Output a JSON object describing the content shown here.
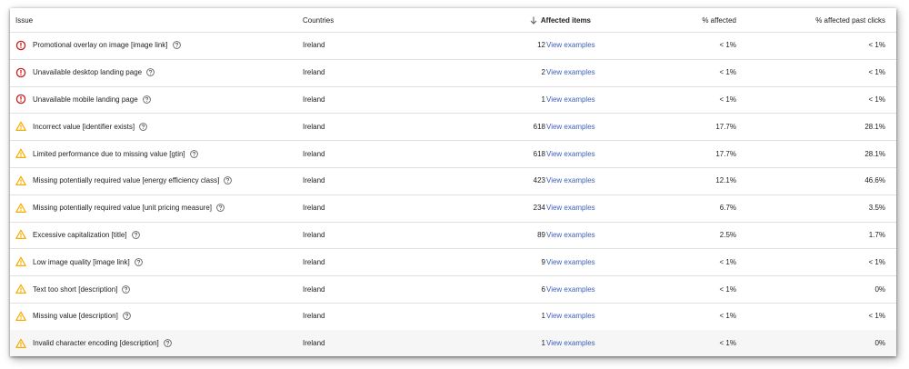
{
  "colors": {
    "error": "#c5221f",
    "warning": "#f9ab00",
    "link": "#3c5fb7",
    "divider": "#e0e0e0"
  },
  "header": {
    "issue": "Issue",
    "countries": "Countries",
    "affected_items": "Affected items",
    "pct_affected": "% affected",
    "pct_past_clicks": "% affected past clicks",
    "sort_icon": "arrow-down-icon"
  },
  "rows": [
    {
      "severity": "error",
      "issue": "Promotional overlay on image [image link]",
      "country": "Ireland",
      "count": "12",
      "link": "View examples",
      "pct": "< 1%",
      "past": "< 1%"
    },
    {
      "severity": "error",
      "issue": "Unavailable desktop landing page",
      "country": "Ireland",
      "count": "2",
      "link": "View examples",
      "pct": "< 1%",
      "past": "< 1%"
    },
    {
      "severity": "error",
      "issue": "Unavailable mobile landing page",
      "country": "Ireland",
      "count": "1",
      "link": "View examples",
      "pct": "< 1%",
      "past": "< 1%"
    },
    {
      "severity": "warning",
      "issue": "Incorrect value [identifier exists]",
      "country": "Ireland",
      "count": "618",
      "link": "View examples",
      "pct": "17.7%",
      "past": "28.1%"
    },
    {
      "severity": "warning",
      "issue": "Limited performance due to missing value [gtin]",
      "country": "Ireland",
      "count": "618",
      "link": "View examples",
      "pct": "17.7%",
      "past": "28.1%"
    },
    {
      "severity": "warning",
      "issue": "Missing potentially required value [energy efficiency class]",
      "country": "Ireland",
      "count": "423",
      "link": "View examples",
      "pct": "12.1%",
      "past": "46.6%"
    },
    {
      "severity": "warning",
      "issue": "Missing potentially required value [unit pricing measure]",
      "country": "Ireland",
      "count": "234",
      "link": "View examples",
      "pct": "6.7%",
      "past": "3.5%"
    },
    {
      "severity": "warning",
      "issue": "Excessive capitalization [title]",
      "country": "Ireland",
      "count": "89",
      "link": "View examples",
      "pct": "2.5%",
      "past": "1.7%"
    },
    {
      "severity": "warning",
      "issue": "Low image quality [image link]",
      "country": "Ireland",
      "count": "9",
      "link": "View examples",
      "pct": "< 1%",
      "past": "< 1%"
    },
    {
      "severity": "warning",
      "issue": "Text too short [description]",
      "country": "Ireland",
      "count": "6",
      "link": "View examples",
      "pct": "< 1%",
      "past": "0%"
    },
    {
      "severity": "warning",
      "issue": "Missing value [description]",
      "country": "Ireland",
      "count": "1",
      "link": "View examples",
      "pct": "< 1%",
      "past": "< 1%"
    },
    {
      "severity": "warning",
      "issue": "Invalid character encoding [description]",
      "country": "Ireland",
      "count": "1",
      "link": "View examples",
      "pct": "< 1%",
      "past": "0%"
    }
  ]
}
